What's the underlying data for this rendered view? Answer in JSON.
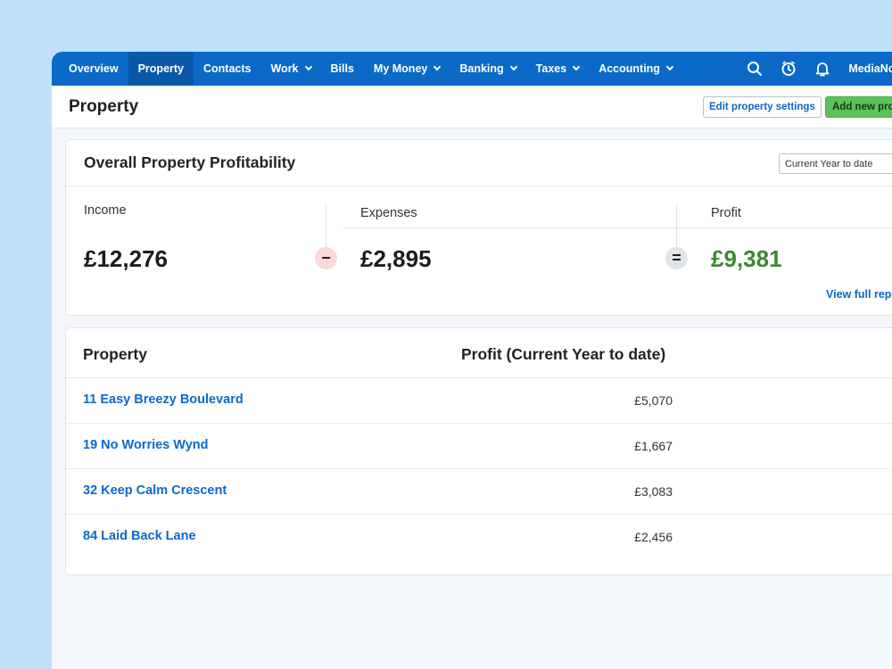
{
  "nav": {
    "items": [
      {
        "label": "Overview",
        "active": false,
        "dropdown": false
      },
      {
        "label": "Property",
        "active": true,
        "dropdown": false
      },
      {
        "label": "Contacts",
        "active": false,
        "dropdown": false
      },
      {
        "label": "Work",
        "active": false,
        "dropdown": true
      },
      {
        "label": "Bills",
        "active": false,
        "dropdown": false
      },
      {
        "label": "My Money",
        "active": false,
        "dropdown": true
      },
      {
        "label": "Banking",
        "active": false,
        "dropdown": true
      },
      {
        "label": "Taxes",
        "active": false,
        "dropdown": true
      },
      {
        "label": "Accounting",
        "active": false,
        "dropdown": true
      }
    ],
    "icons": [
      "search-icon",
      "timer-icon",
      "bell-icon"
    ],
    "user": "MediaNode"
  },
  "header": {
    "title": "Property",
    "edit_button": "Edit property settings",
    "add_button": "Add new pro"
  },
  "profitability": {
    "title": "Overall Property Profitability",
    "period": "Current Year to date",
    "income_label": "Income",
    "income_value": "£12,276",
    "minus_symbol": "−",
    "expenses_label": "Expenses",
    "expenses_value": "£2,895",
    "equals_symbol": "=",
    "profit_label": "Profit",
    "profit_value": "£9,381",
    "report_link": "View full repo"
  },
  "table": {
    "col_property": "Property",
    "col_profit": "Profit (Current Year to date)",
    "rows": [
      {
        "name": "11 Easy Breezy Boulevard",
        "profit": "£5,070"
      },
      {
        "name": "19 No Worries Wynd",
        "profit": "£1,667"
      },
      {
        "name": "32 Keep Calm Crescent",
        "profit": "£3,083"
      },
      {
        "name": "84 Laid Back Lane",
        "profit": "£2,456"
      }
    ]
  },
  "colors": {
    "nav_bg": "#0b69c7",
    "nav_active": "#0a58a9",
    "link": "#0b69c7",
    "profit_green": "#3b8a2e",
    "add_button_green": "#5cc05c",
    "outer_bg": "#bfe0fb"
  }
}
